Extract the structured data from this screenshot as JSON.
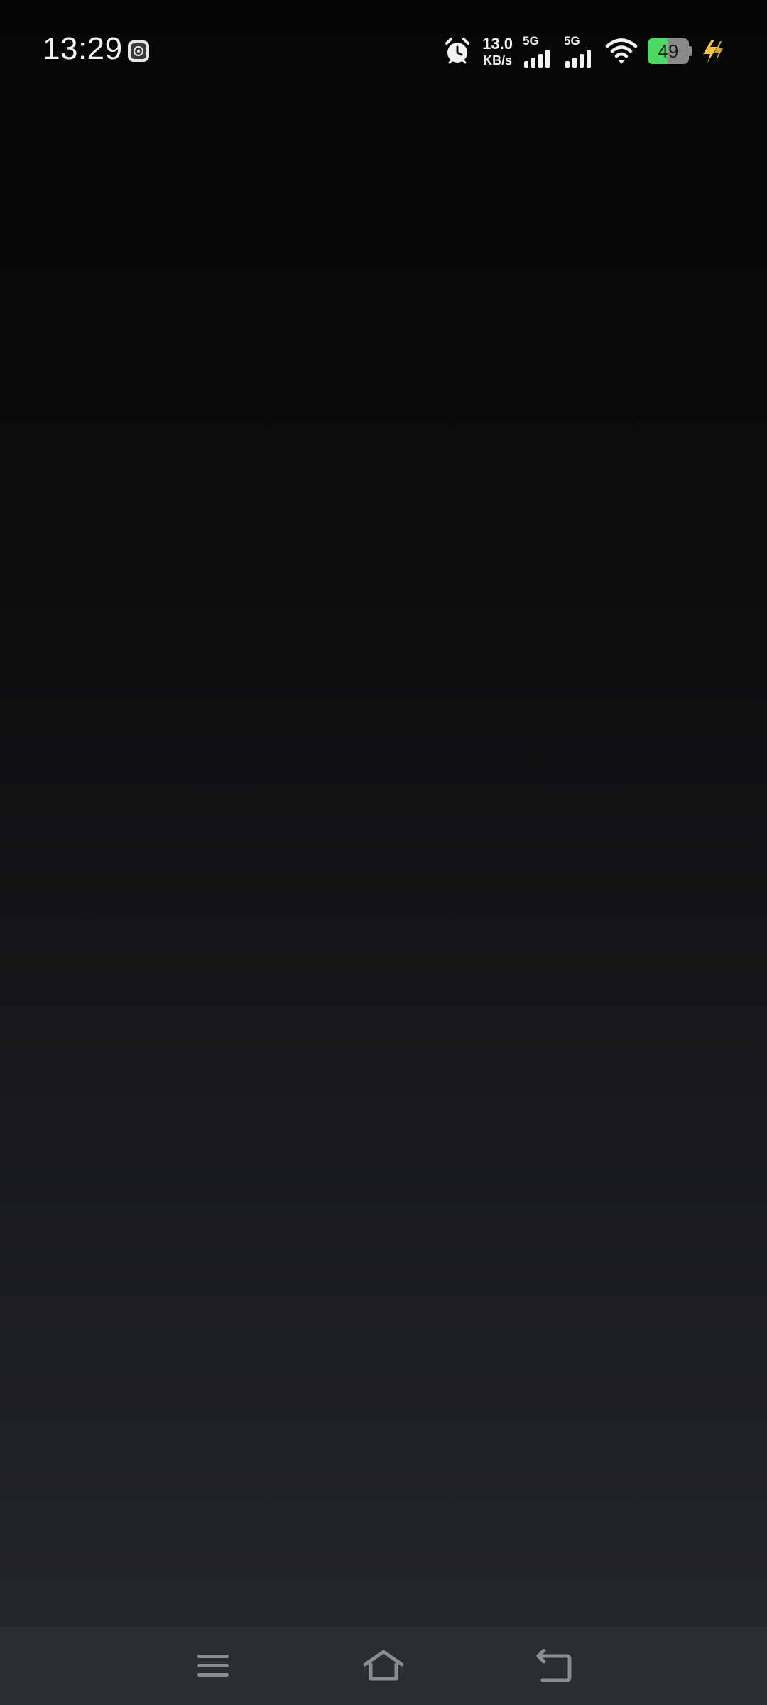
{
  "status_bar": {
    "time": "13:29",
    "net_speed_value": "13.0",
    "net_speed_unit": "KB/s",
    "sim1_label": "5G",
    "sim2_label": "5G",
    "battery_level": "49",
    "battery_fraction": 0.49,
    "battery_color": "#4cd964",
    "charging_color": "#f4c242",
    "icons": [
      "notification-app-icon",
      "alarm-icon",
      "signal-icon",
      "signal-icon",
      "wifi-icon",
      "battery-icon",
      "charging-icon"
    ]
  },
  "nav_bar": {
    "buttons": [
      "menu-icon",
      "home-icon",
      "back-icon"
    ]
  }
}
